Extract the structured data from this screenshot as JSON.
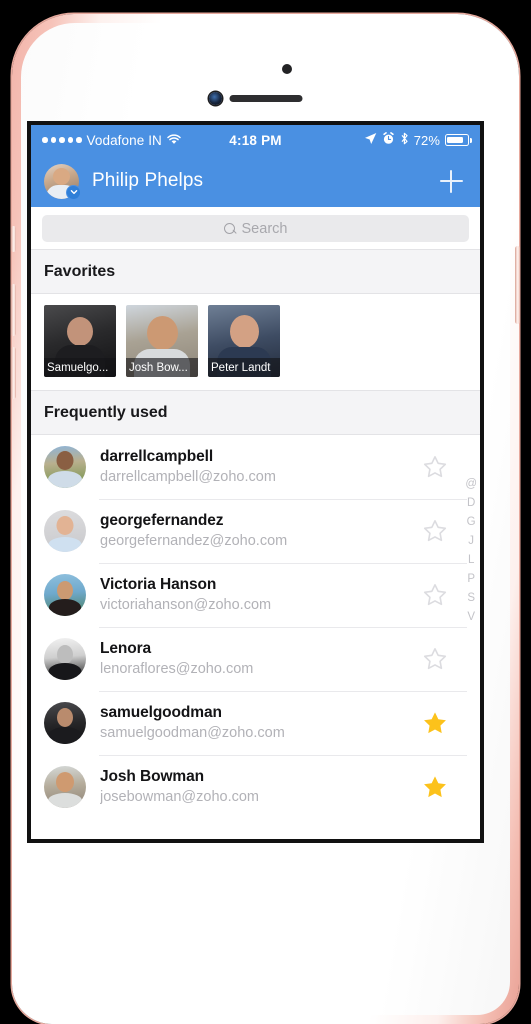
{
  "status_bar": {
    "signal_dots": 5,
    "carrier": "Vodafone IN",
    "wifi_icon": "wifi-icon",
    "time": "4:18 PM",
    "location_icon": "location-arrow-icon",
    "alarm_icon": "alarm-clock-icon",
    "bluetooth_icon": "bluetooth-icon",
    "battery_percent": "72%",
    "battery_icon": "battery-icon"
  },
  "nav_bar": {
    "avatar_name": "user-avatar",
    "status_badge_icon": "chevron-down-icon",
    "title": "Philip Phelps",
    "add_button_icon": "plus-icon",
    "background_color": "#4a90e2"
  },
  "search": {
    "icon": "search-icon",
    "placeholder": "Search",
    "value": ""
  },
  "sections": {
    "favorites_title": "Favorites",
    "frequently_used_title": "Frequently used"
  },
  "favorites": [
    {
      "label": "Samuelgo..."
    },
    {
      "label": "Josh Bow..."
    },
    {
      "label": "Peter Landt"
    }
  ],
  "contacts": [
    {
      "name": "darrellcampbell",
      "email": "darrellcampbell@zoho.com",
      "starred": false
    },
    {
      "name": "georgefernandez",
      "email": "georgefernandez@zoho.com",
      "starred": false
    },
    {
      "name": "Victoria Hanson",
      "email": "victoriahanson@zoho.com",
      "starred": false
    },
    {
      "name": "Lenora",
      "email": "lenoraflores@zoho.com",
      "starred": false
    },
    {
      "name": "samuelgoodman",
      "email": "samuelgoodman@zoho.com",
      "starred": true
    },
    {
      "name": "Josh Bowman",
      "email": "josebowman@zoho.com",
      "starred": true
    }
  ],
  "index_letters": [
    "@",
    "D",
    "G",
    "J",
    "L",
    "P",
    "S",
    "V"
  ],
  "colors": {
    "accent_blue": "#4a90e2",
    "star_gold": "#fcc21b",
    "star_empty": "#dcdce0",
    "section_bg": "#f4f4f6",
    "secondary_text": "#b2b2b7"
  }
}
